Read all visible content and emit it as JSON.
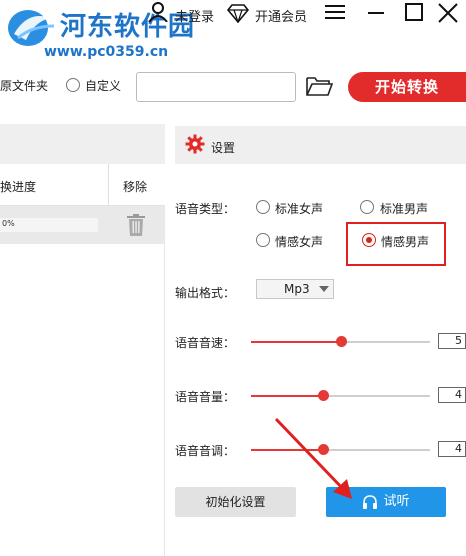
{
  "watermark": {
    "site_name": "河东软件园",
    "url": "www.pc0359.cn"
  },
  "titlebar": {
    "login_label": "未登录",
    "vip_label": "开通会员"
  },
  "output": {
    "source_folder_label": "原文件夹",
    "custom_label": "自定义",
    "path_value": "",
    "start_button": "开始转换"
  },
  "file_list": {
    "columns": [
      "换进度",
      "移除"
    ],
    "rows": [
      {
        "progress_text": "0%",
        "progress": 0.0
      }
    ]
  },
  "settings": {
    "title": "设置",
    "voice_type_label": "语音类型：",
    "voice_options": [
      {
        "label": "标准女声",
        "checked": false
      },
      {
        "label": "标准男声",
        "checked": false
      },
      {
        "label": "情感女声",
        "checked": false
      },
      {
        "label": "情感男声",
        "checked": true
      }
    ],
    "format_label": "输出格式：",
    "format_value": "Mp3",
    "speed_label": "语音音速：",
    "speed_value": "5",
    "speed_level": 0.5,
    "volume_label": "语音音量：",
    "volume_value": "4",
    "volume_level": 0.4,
    "pitch_label": "语音音调：",
    "pitch_value": "4",
    "pitch_level": 0.4,
    "reset_button": "初始化设置",
    "listen_button": "试听"
  },
  "colors": {
    "accent_red": "#e22b2b",
    "listen_blue": "#2196e8",
    "watermark_blue": "#1d74c9",
    "annotation_red": "#e02020"
  },
  "icons": {
    "user": "user-icon",
    "vip": "diamond-icon",
    "menu": "hamburger-menu-icon",
    "minimize": "minimize-icon",
    "maximize": "maximize-icon",
    "close": "close-icon",
    "folder": "folder-open-icon",
    "trash": "trash-icon",
    "settings": "gear-icon",
    "listen": "headphones-icon"
  }
}
